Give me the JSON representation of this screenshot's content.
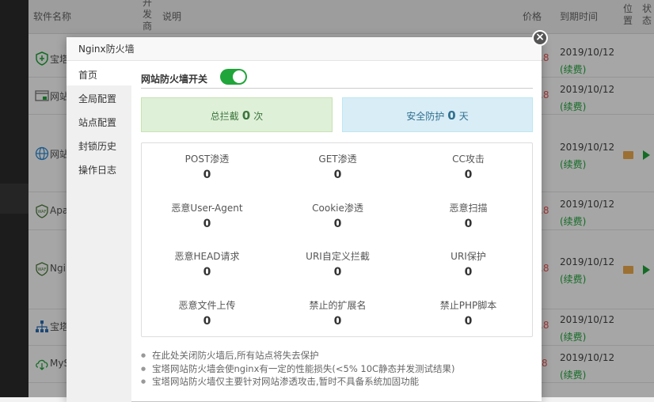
{
  "table": {
    "headers": {
      "name": "软件名称",
      "dev": "开发商",
      "desc": "说明",
      "price": "价格",
      "expiry": "到期时间",
      "position": "位置",
      "status": "状态"
    },
    "rows": [
      {
        "name": "宝塔",
        "price": ".8",
        "date": "2019/10/12",
        "renew": "(续费)",
        "icon": "shield-icon"
      },
      {
        "name": "网站",
        "price": ".8",
        "date": "2019/10/12",
        "renew": "(续费)",
        "icon": "window-lock-icon"
      },
      {
        "name": "网站",
        "price": "",
        "date": "2019/10/12",
        "renew": "(续费)",
        "icon": "globe-icon"
      },
      {
        "name": "Apa",
        "price": ".8",
        "date": "2019/10/12",
        "renew": "(续费)",
        "icon": "waf-icon"
      },
      {
        "name": "Ngi",
        "price": ".8",
        "date": "2019/10/12",
        "renew": "(续费)",
        "icon": "waf-icon"
      },
      {
        "name": "宝塔",
        "price": ".8",
        "date": "2019/10/12",
        "renew": "(续费)",
        "icon": "sitemap-icon"
      },
      {
        "name": "MyS",
        "price": "8",
        "date": "2019/10/12",
        "renew": "(续费)",
        "icon": "cloud-download-icon"
      }
    ]
  },
  "modal": {
    "title": "Nginx防火墙",
    "close": "×",
    "sidebar": [
      "首页",
      "全局配置",
      "站点配置",
      "封锁历史",
      "操作日志"
    ],
    "switch_label": "网站防火墙开关",
    "switch_on": true,
    "total_block": {
      "prefix": "总拦截",
      "value": "0",
      "suffix": "次"
    },
    "safe_days": {
      "prefix": "安全防护",
      "value": "0",
      "suffix": "天"
    },
    "stats": [
      {
        "label": "POST渗透",
        "value": "0"
      },
      {
        "label": "GET渗透",
        "value": "0"
      },
      {
        "label": "CC攻击",
        "value": "0"
      },
      {
        "label": "恶意User-Agent",
        "value": "0"
      },
      {
        "label": "Cookie渗透",
        "value": "0"
      },
      {
        "label": "恶意扫描",
        "value": "0"
      },
      {
        "label": "恶意HEAD请求",
        "value": "0"
      },
      {
        "label": "URI自定义拦截",
        "value": "0"
      },
      {
        "label": "URI保护",
        "value": "0"
      },
      {
        "label": "恶意文件上传",
        "value": "0"
      },
      {
        "label": "禁止的扩展名",
        "value": "0"
      },
      {
        "label": "禁止PHP脚本",
        "value": "0"
      }
    ],
    "notes": [
      "在此处关闭防火墙后,所有站点将失去保护",
      "宝塔网站防火墙会使nginx有一定的性能损失(<5% 10C静态并发测试结果)",
      "宝塔网站防火墙仅主要针对网站渗透攻击,暂时不具备系统加固功能"
    ]
  },
  "colors": {
    "accent": "#20a53a",
    "price": "#f05656"
  }
}
